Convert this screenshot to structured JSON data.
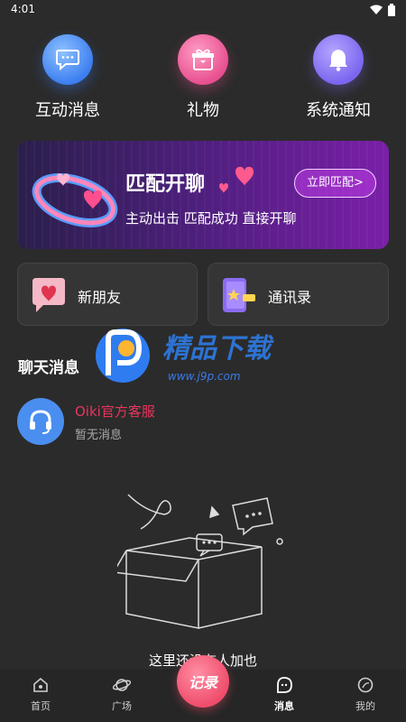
{
  "status": {
    "time": "4:01"
  },
  "top_actions": [
    {
      "label": "互动消息",
      "icon": "chat-bubble-icon",
      "color": "#3d7ff0"
    },
    {
      "label": "礼物",
      "icon": "gift-icon",
      "color": "#e8508f"
    },
    {
      "label": "系统通知",
      "icon": "bell-icon",
      "color": "#7a66ef"
    }
  ],
  "match_card": {
    "title": "匹配开聊",
    "subtitle": "主动出击 匹配成功 直接开聊",
    "button": "立即匹配>"
  },
  "tiles": [
    {
      "label": "新朋友",
      "icon": "heart-bubble-icon"
    },
    {
      "label": "通讯录",
      "icon": "contact-book-icon"
    }
  ],
  "section_title": "聊天消息",
  "chats": [
    {
      "name": "Oiki官方客服",
      "preview": "暂无消息",
      "icon": "headset-icon"
    }
  ],
  "empty_text": "这里还没有人加也",
  "watermark": {
    "text": "www.j9p.com"
  },
  "tabbar": {
    "items": [
      {
        "label": "首页",
        "icon": "home-icon"
      },
      {
        "label": "广场",
        "icon": "planet-icon"
      },
      {
        "label": "消息",
        "icon": "message-icon",
        "active": true
      },
      {
        "label": "我的",
        "icon": "profile-icon"
      }
    ],
    "center": "记录"
  },
  "colors": {
    "accent": "#ef4d6b",
    "chat_name": "#e8365d",
    "background": "#2b2b2b"
  }
}
